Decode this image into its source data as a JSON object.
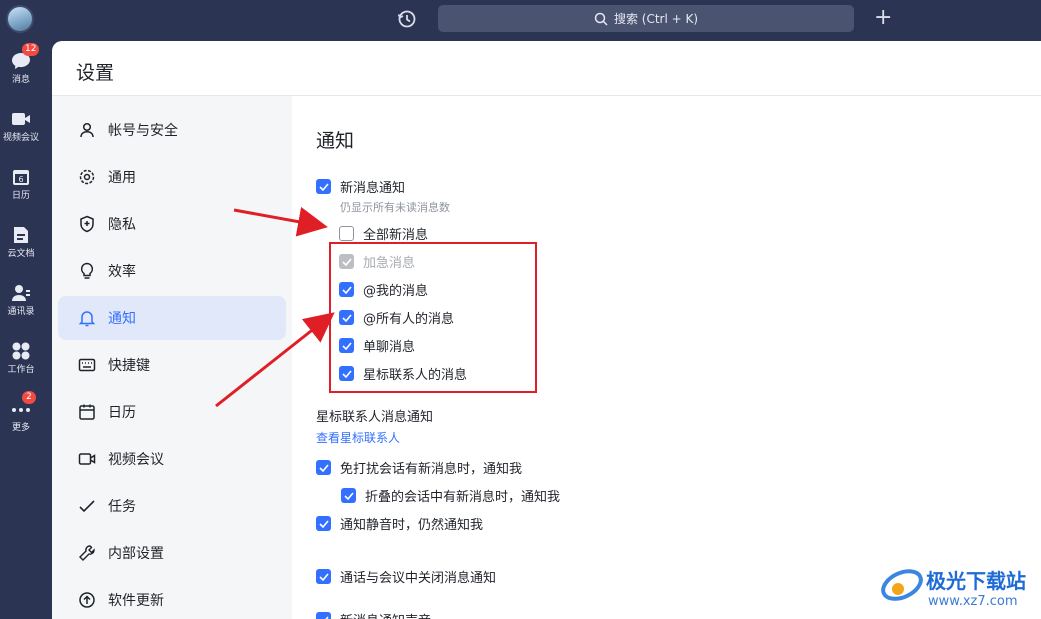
{
  "sidebar_rail": {
    "items": [
      {
        "label": "消息",
        "badge": "12",
        "icon": "chat-icon"
      },
      {
        "label": "视频会议",
        "icon": "video-icon"
      },
      {
        "label": "日历",
        "icon": "calendar-icon"
      },
      {
        "label": "云文档",
        "icon": "docs-icon"
      },
      {
        "label": "通讯录",
        "icon": "contacts-icon"
      },
      {
        "label": "工作台",
        "icon": "grid-icon"
      },
      {
        "label": "更多",
        "badge": "2",
        "icon": "more-icon"
      }
    ]
  },
  "topbar": {
    "search_placeholder": "搜索 (Ctrl + K)",
    "add_icon": "plus-icon",
    "history_icon": "history-icon"
  },
  "window": {
    "title": "设置"
  },
  "settings_nav": {
    "active_index": 4,
    "accent": "#3370ff",
    "items": [
      {
        "label": "帐号与安全",
        "icon": "user-icon"
      },
      {
        "label": "通用",
        "icon": "gear-icon"
      },
      {
        "label": "隐私",
        "icon": "shield-icon"
      },
      {
        "label": "效率",
        "icon": "bulb-icon"
      },
      {
        "label": "通知",
        "icon": "bell-icon"
      },
      {
        "label": "快捷键",
        "icon": "keyboard-icon"
      },
      {
        "label": "日历",
        "icon": "calendar-icon"
      },
      {
        "label": "视频会议",
        "icon": "video-icon"
      },
      {
        "label": "任务",
        "icon": "check-icon"
      },
      {
        "label": "内部设置",
        "icon": "wrench-icon"
      },
      {
        "label": "软件更新",
        "icon": "upgrade-icon"
      }
    ]
  },
  "notifications": {
    "heading": "通知",
    "new_message": {
      "label": "新消息通知",
      "checked": true
    },
    "hint": "仍显示所有未读消息数",
    "all_new": {
      "label": "全部新消息",
      "checked": false
    },
    "urgent": {
      "label": "加急消息",
      "checked": true,
      "disabled": true
    },
    "mention_me": {
      "label": "@我的消息",
      "checked": true
    },
    "mention_all": {
      "label": "@所有人的消息",
      "checked": true
    },
    "direct": {
      "label": "单聊消息",
      "checked": true
    },
    "starred": {
      "label": "星标联系人的消息",
      "checked": true
    },
    "starred_section": "星标联系人消息通知",
    "view_starred_link": "查看星标联系人",
    "dnd": {
      "label": "免打扰会话有新消息时，通知我",
      "checked": true
    },
    "folded": {
      "label": "折叠的会话中有新消息时，通知我",
      "checked": true
    },
    "muted": {
      "label": "通知静音时，仍然通知我",
      "checked": true
    },
    "call_meeting": {
      "label": "通话与会议中关闭消息通知",
      "checked": true
    },
    "sound": {
      "label": "新消息通知声音",
      "checked": true
    }
  },
  "watermark": {
    "title": "极光下载站",
    "url": "www.xz7.com"
  }
}
